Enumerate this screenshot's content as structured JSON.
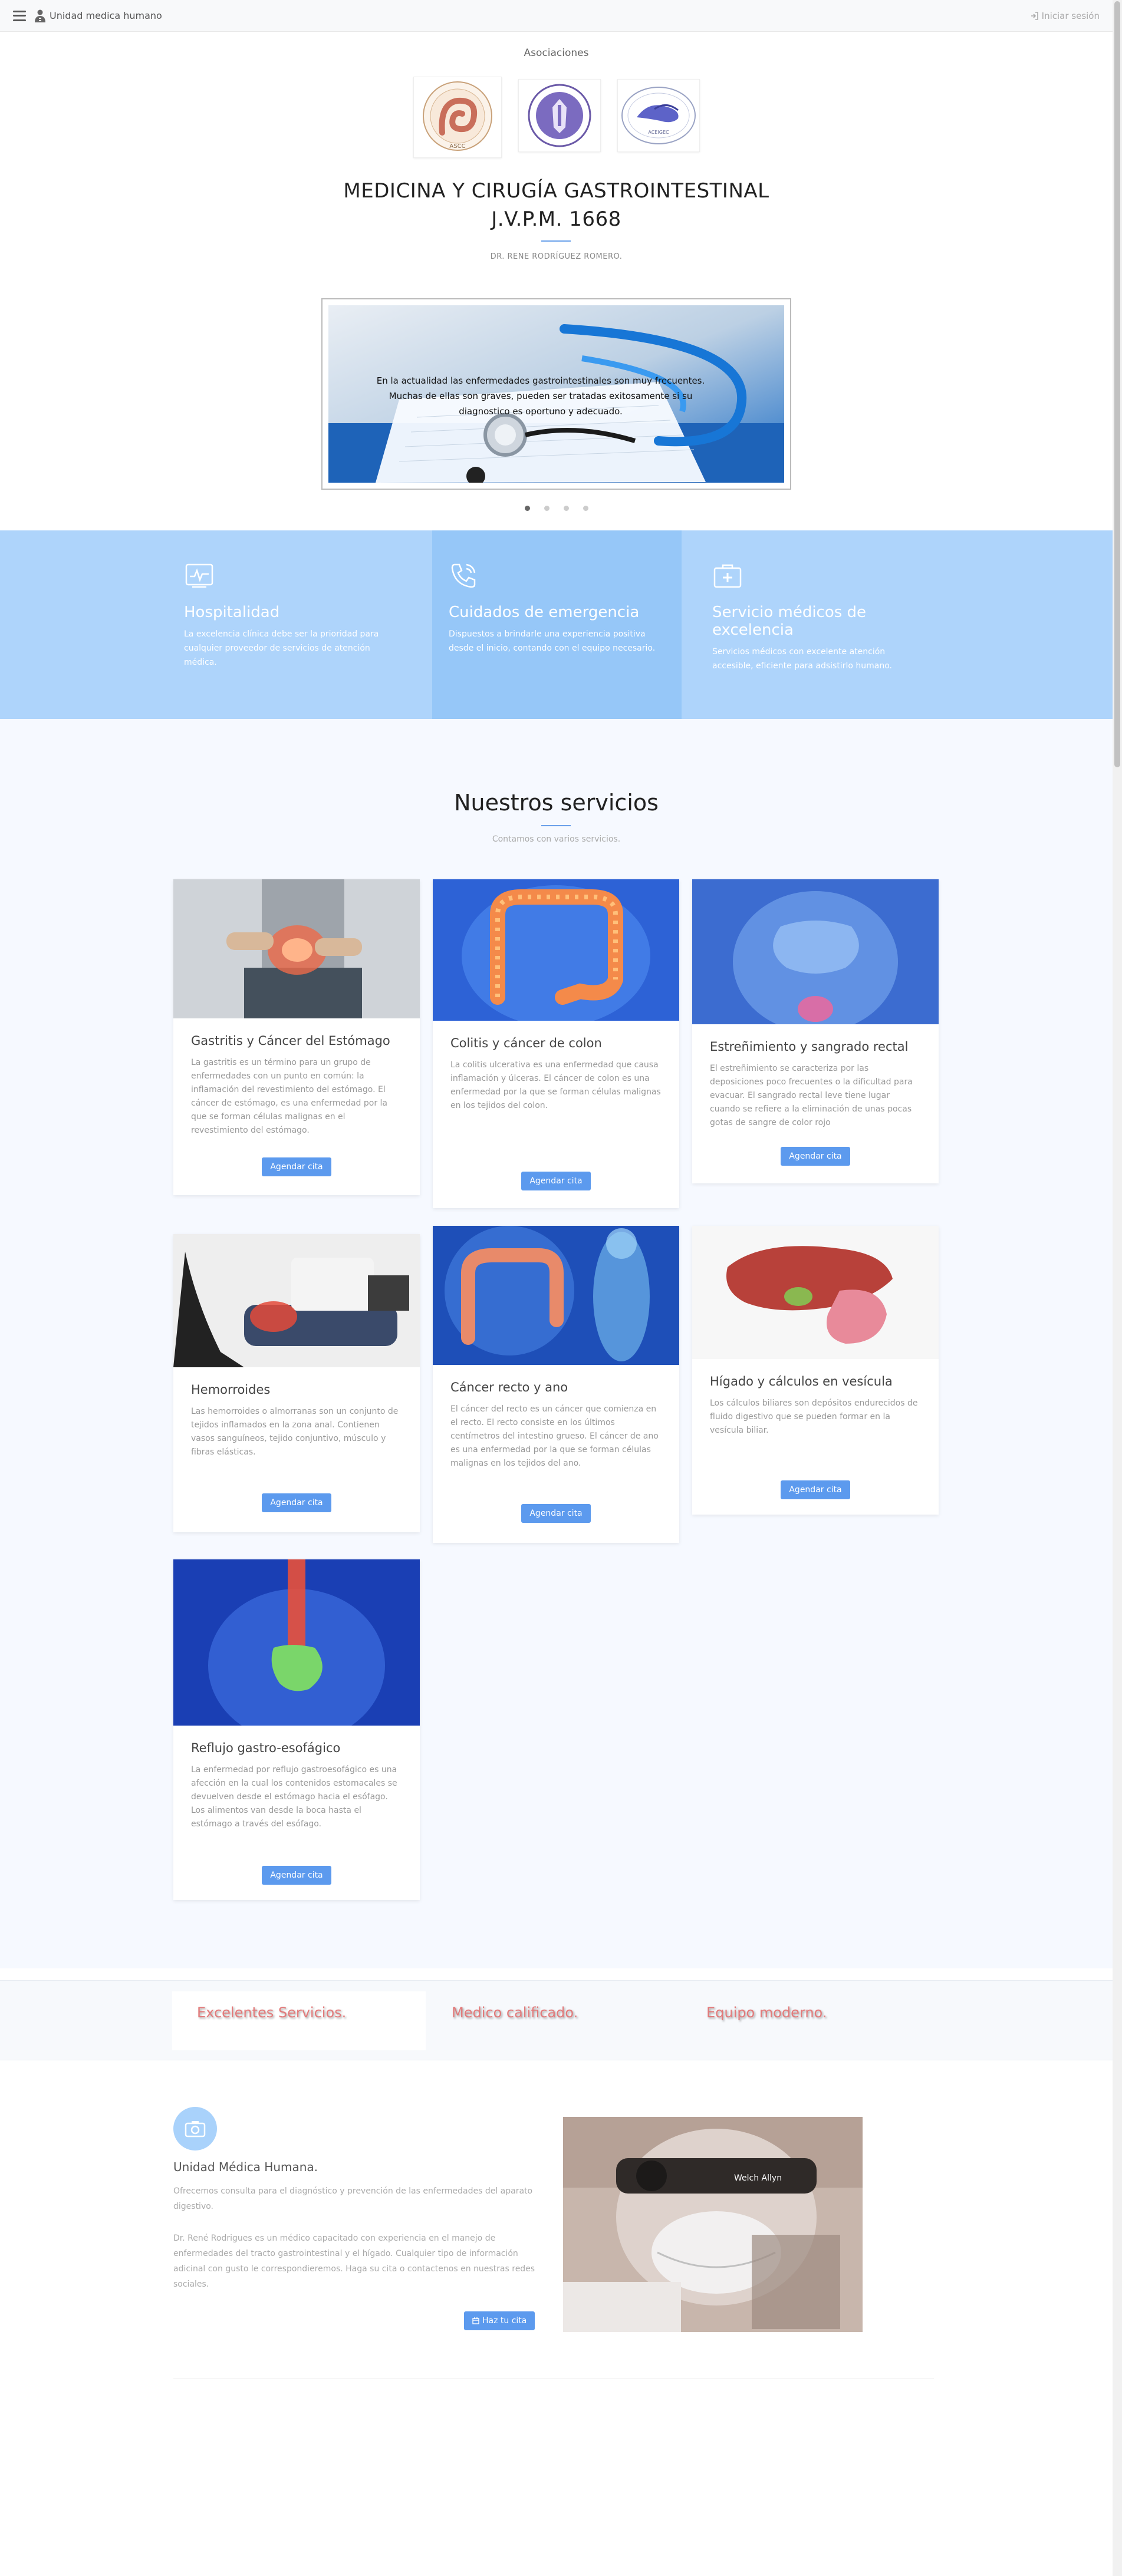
{
  "navbar": {
    "brand": "Unidad medica humano",
    "login": "Iniciar sesión"
  },
  "associations": {
    "title": "Asociaciones",
    "logo1_text": "ASCC",
    "logo3_text": "ACEIGEC"
  },
  "hero": {
    "title_line1": "MEDICINA Y CIRUGÍA GASTROINTESTINAL",
    "title_line2": "J.V.P.M. 1668",
    "doctor": "DR. RENE RODRÍGUEZ ROMERO."
  },
  "carousel": {
    "caption_line1": "En la actualidad las enfermedades gastrointestinales son muy frecuentes.",
    "caption_line2": "Muchas de ellas son graves, pueden ser tratadas exitosamente si su",
    "caption_line3": "diagnostico es oportuno y adecuado.",
    "slides": 4,
    "active": 1
  },
  "features": [
    {
      "icon": "hospital-monitor-icon",
      "title": "Hospitalidad",
      "text": "La excelencia clínica debe ser la prioridad para cualquier proveedor de servicios de atención médica."
    },
    {
      "icon": "phone-call-icon",
      "title": "Cuidados de emergencia",
      "text": "Dispuestos a brindarle una experiencia positiva desde el inicio, contando con el equipo necesario."
    },
    {
      "icon": "medical-kit-icon",
      "title": "Servicio médicos de excelencia",
      "text": "Servicios médicos con excelente atención accesible, eficiente para adsistirlo humano."
    }
  ],
  "services": {
    "title": "Nuestros servicios",
    "subtitle": "Contamos con varios servicios.",
    "button_label": "Agendar cita",
    "cards": [
      {
        "title": "Gastritis y Cáncer del Estómago",
        "text": "La gastritis es un término para un grupo de enfermedades con un punto en común: la inflamación del revestimiento del estómago. El cáncer de estómago, es una enfermedad por la que se forman células malignas en el revestimiento del estómago."
      },
      {
        "title": "Colitis y cáncer de colon",
        "text": "La colitis ulcerativa es una enfermedad que causa inflamación y úlceras. El cáncer de colon es una enfermedad por la que se forman células malignas en los tejidos del colon."
      },
      {
        "title": "Estreñimiento y sangrado rectal",
        "text": "El estreñimiento se caracteriza por las deposiciones poco frecuentes o la dificultad para evacuar. El sangrado rectal leve tiene lugar cuando se refiere a la eliminación de unas pocas gotas de sangre de color rojo"
      },
      {
        "title": "Hemorroides",
        "text": "Las hemorroides o almorranas son un conjunto de tejidos inflamados en la zona anal. Contienen vasos sanguíneos, tejido conjuntivo, músculo y fibras elásticas."
      },
      {
        "title": "Cáncer recto y ano",
        "text": "El cáncer del recto es un cáncer que comienza en el recto. El recto consiste en los últimos centímetros del intestino grueso. El cáncer de ano es una enfermedad por la que se forman células malignas en los tejidos del ano."
      },
      {
        "title": "Hígado y cálculos en vesícula",
        "text": "Los cálculos biliares son depósitos endurecidos de fluido digestivo que se pueden formar en la vesícula biliar."
      },
      {
        "title": "Reflujo gastro-esofágico",
        "text": "La enfermedad por reflujo gastroesofágico es una afección en la cual los contenidos estomacales se devuelven desde el estómago hacia el esófago. Los alimentos van desde la boca hasta el estómago a través del esófago."
      }
    ]
  },
  "band": {
    "item1": "Excelentes Servicios.",
    "item2": "Medico calificado.",
    "item3": "Equipo moderno."
  },
  "about": {
    "title": "Unidad Médica Humana.",
    "text1": "Ofrecemos consulta para el diagnóstico y prevención de las enfermedades del aparato digestivo.",
    "text2": "Dr. René Rodrigues es un médico capacitado con experiencia en el manejo de enfermedades del tracto gastrointestinal y el hígado. Cualquier tipo de información adicinal con gusto le correspondieremos. Haga su cita o contactenos en nuestras redes sociales.",
    "button": "Haz tu cita",
    "photo_text": "Welch Allyn"
  },
  "colors": {
    "accent": "#5c9aee",
    "feature_bg": "#aed4fb",
    "band_text": "#e27a7a"
  }
}
